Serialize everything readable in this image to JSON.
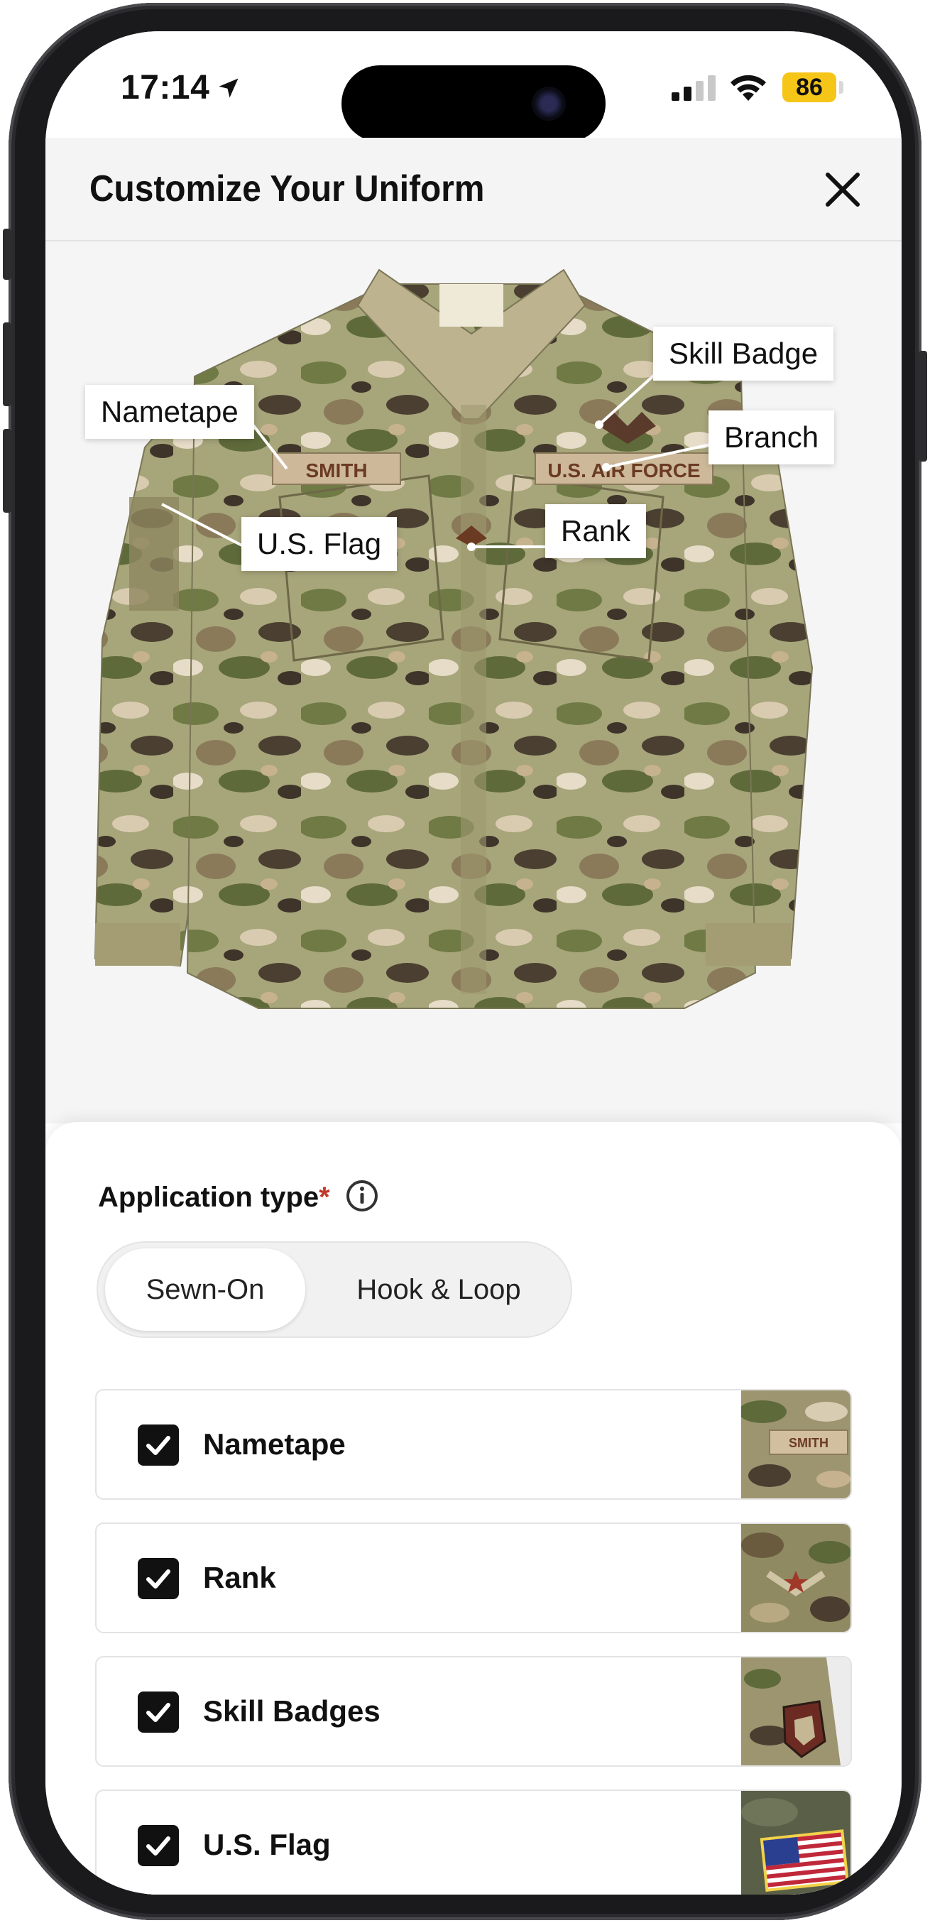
{
  "status_bar": {
    "time": "17:14",
    "battery": "86",
    "battery_color": "#F5C518"
  },
  "header": {
    "title": "Customize Your Uniform",
    "close_icon": "close-icon"
  },
  "hero": {
    "nametape_text": "SMITH",
    "branch_text": "U.S. AIR FORCE",
    "callouts": {
      "skill_badge": "Skill Badge",
      "nametape": "Nametape",
      "branch": "Branch",
      "us_flag": "U.S. Flag",
      "rank": "Rank"
    }
  },
  "sheet": {
    "application_type_label": "Application type",
    "required_mark": "*",
    "segment": {
      "selected": "Sewn-On",
      "options": [
        "Sewn-On",
        "Hook & Loop"
      ]
    },
    "options": [
      {
        "label": "Nametape",
        "checked": true,
        "thumb_text": "SMITH"
      },
      {
        "label": "Rank",
        "checked": true
      },
      {
        "label": "Skill Badges",
        "checked": true
      },
      {
        "label": "U.S. Flag",
        "checked": true
      }
    ]
  }
}
